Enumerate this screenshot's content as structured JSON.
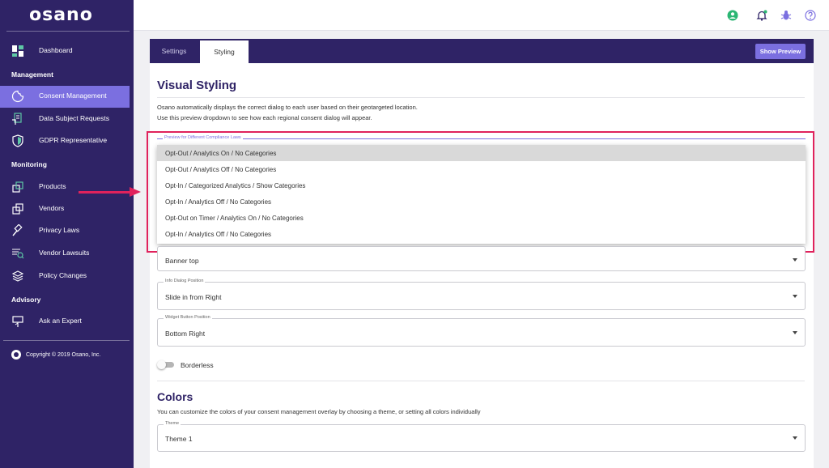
{
  "app": {
    "logo": "osano"
  },
  "sidebar": {
    "items": [
      {
        "label": "Dashboard",
        "icon": "dashboard-icon"
      },
      {
        "label": "Consent Management",
        "icon": "cookie-icon"
      },
      {
        "label": "Data Subject Requests",
        "icon": "dsr-icon"
      },
      {
        "label": "GDPR Representative",
        "icon": "shield-icon"
      },
      {
        "label": "Products",
        "icon": "products-icon"
      },
      {
        "label": "Vendors",
        "icon": "vendors-icon"
      },
      {
        "label": "Privacy Laws",
        "icon": "gavel-icon"
      },
      {
        "label": "Vendor Lawsuits",
        "icon": "lawsuit-icon"
      },
      {
        "label": "Policy Changes",
        "icon": "layers-icon"
      },
      {
        "label": "Ask an Expert",
        "icon": "expert-icon"
      }
    ],
    "sections": [
      "Management",
      "Monitoring",
      "Advisory"
    ],
    "copyright": "Copyright © 2019 Osano, Inc."
  },
  "tabs": [
    {
      "label": "Settings"
    },
    {
      "label": "Styling"
    }
  ],
  "show_preview_label": "Show Preview",
  "visual_styling": {
    "title": "Visual Styling",
    "desc1": "Osano automatically displays the correct dialog to each user based on their geotargeted location.",
    "desc2": "Use this preview dropdown to see how each regional consent dialog will appear."
  },
  "preview_dropdown": {
    "label": "Preview for Different Compliance Laws",
    "options": [
      "Opt-Out / Analytics On /  No Categories",
      "Opt-Out / Analytics Off /  No Categories",
      "Opt-In / Categorized Analytics / Show Categories",
      "Opt-In / Analytics Off /  No Categories",
      "Opt-Out on Timer / Analytics On /  No Categories",
      "Opt-In / Analytics Off /  No Categories"
    ]
  },
  "fields": {
    "banner_position": {
      "value": "Banner top"
    },
    "info_dialog": {
      "label": "Info Dialog Position",
      "value": "Slide in from Right"
    },
    "widget_button": {
      "label": "Widget Button Position",
      "value": "Bottom Right"
    },
    "theme": {
      "label": "Theme",
      "value": "Theme 1"
    }
  },
  "borderless_label": "Borderless",
  "colors": {
    "title": "Colors",
    "desc": "You can customize the colors of your consent management overlay by choosing a theme, or setting all colors individually"
  },
  "accent_colors": {
    "brand": "#2f2366",
    "accent": "#7b6fe0",
    "highlight": "#e0225c",
    "status": "#2bb673"
  }
}
